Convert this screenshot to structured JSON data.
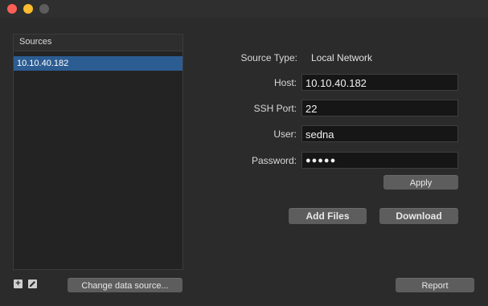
{
  "window": {
    "controls": [
      "close",
      "minimize",
      "maximize"
    ]
  },
  "sources": {
    "header": "Sources",
    "items": [
      "10.10.40.182"
    ],
    "add_icon": "plus-icon",
    "edit_icon": "pencil-icon",
    "change_button": "Change data source..."
  },
  "form": {
    "source_type_label": "Source Type:",
    "source_type_value": "Local Network",
    "host_label": "Host:",
    "host_value": "10.10.40.182",
    "ssh_port_label": "SSH Port:",
    "ssh_port_value": "22",
    "user_label": "User:",
    "user_value": "sedna",
    "password_label": "Password:",
    "password_value": "●●●●●",
    "apply_button": "Apply"
  },
  "actions": {
    "add_files_button": "Add Files",
    "download_button": "Download",
    "report_button": "Report"
  },
  "colors": {
    "selection": "#2c5d92",
    "close": "#fe5f57",
    "minimize": "#febc2e"
  }
}
